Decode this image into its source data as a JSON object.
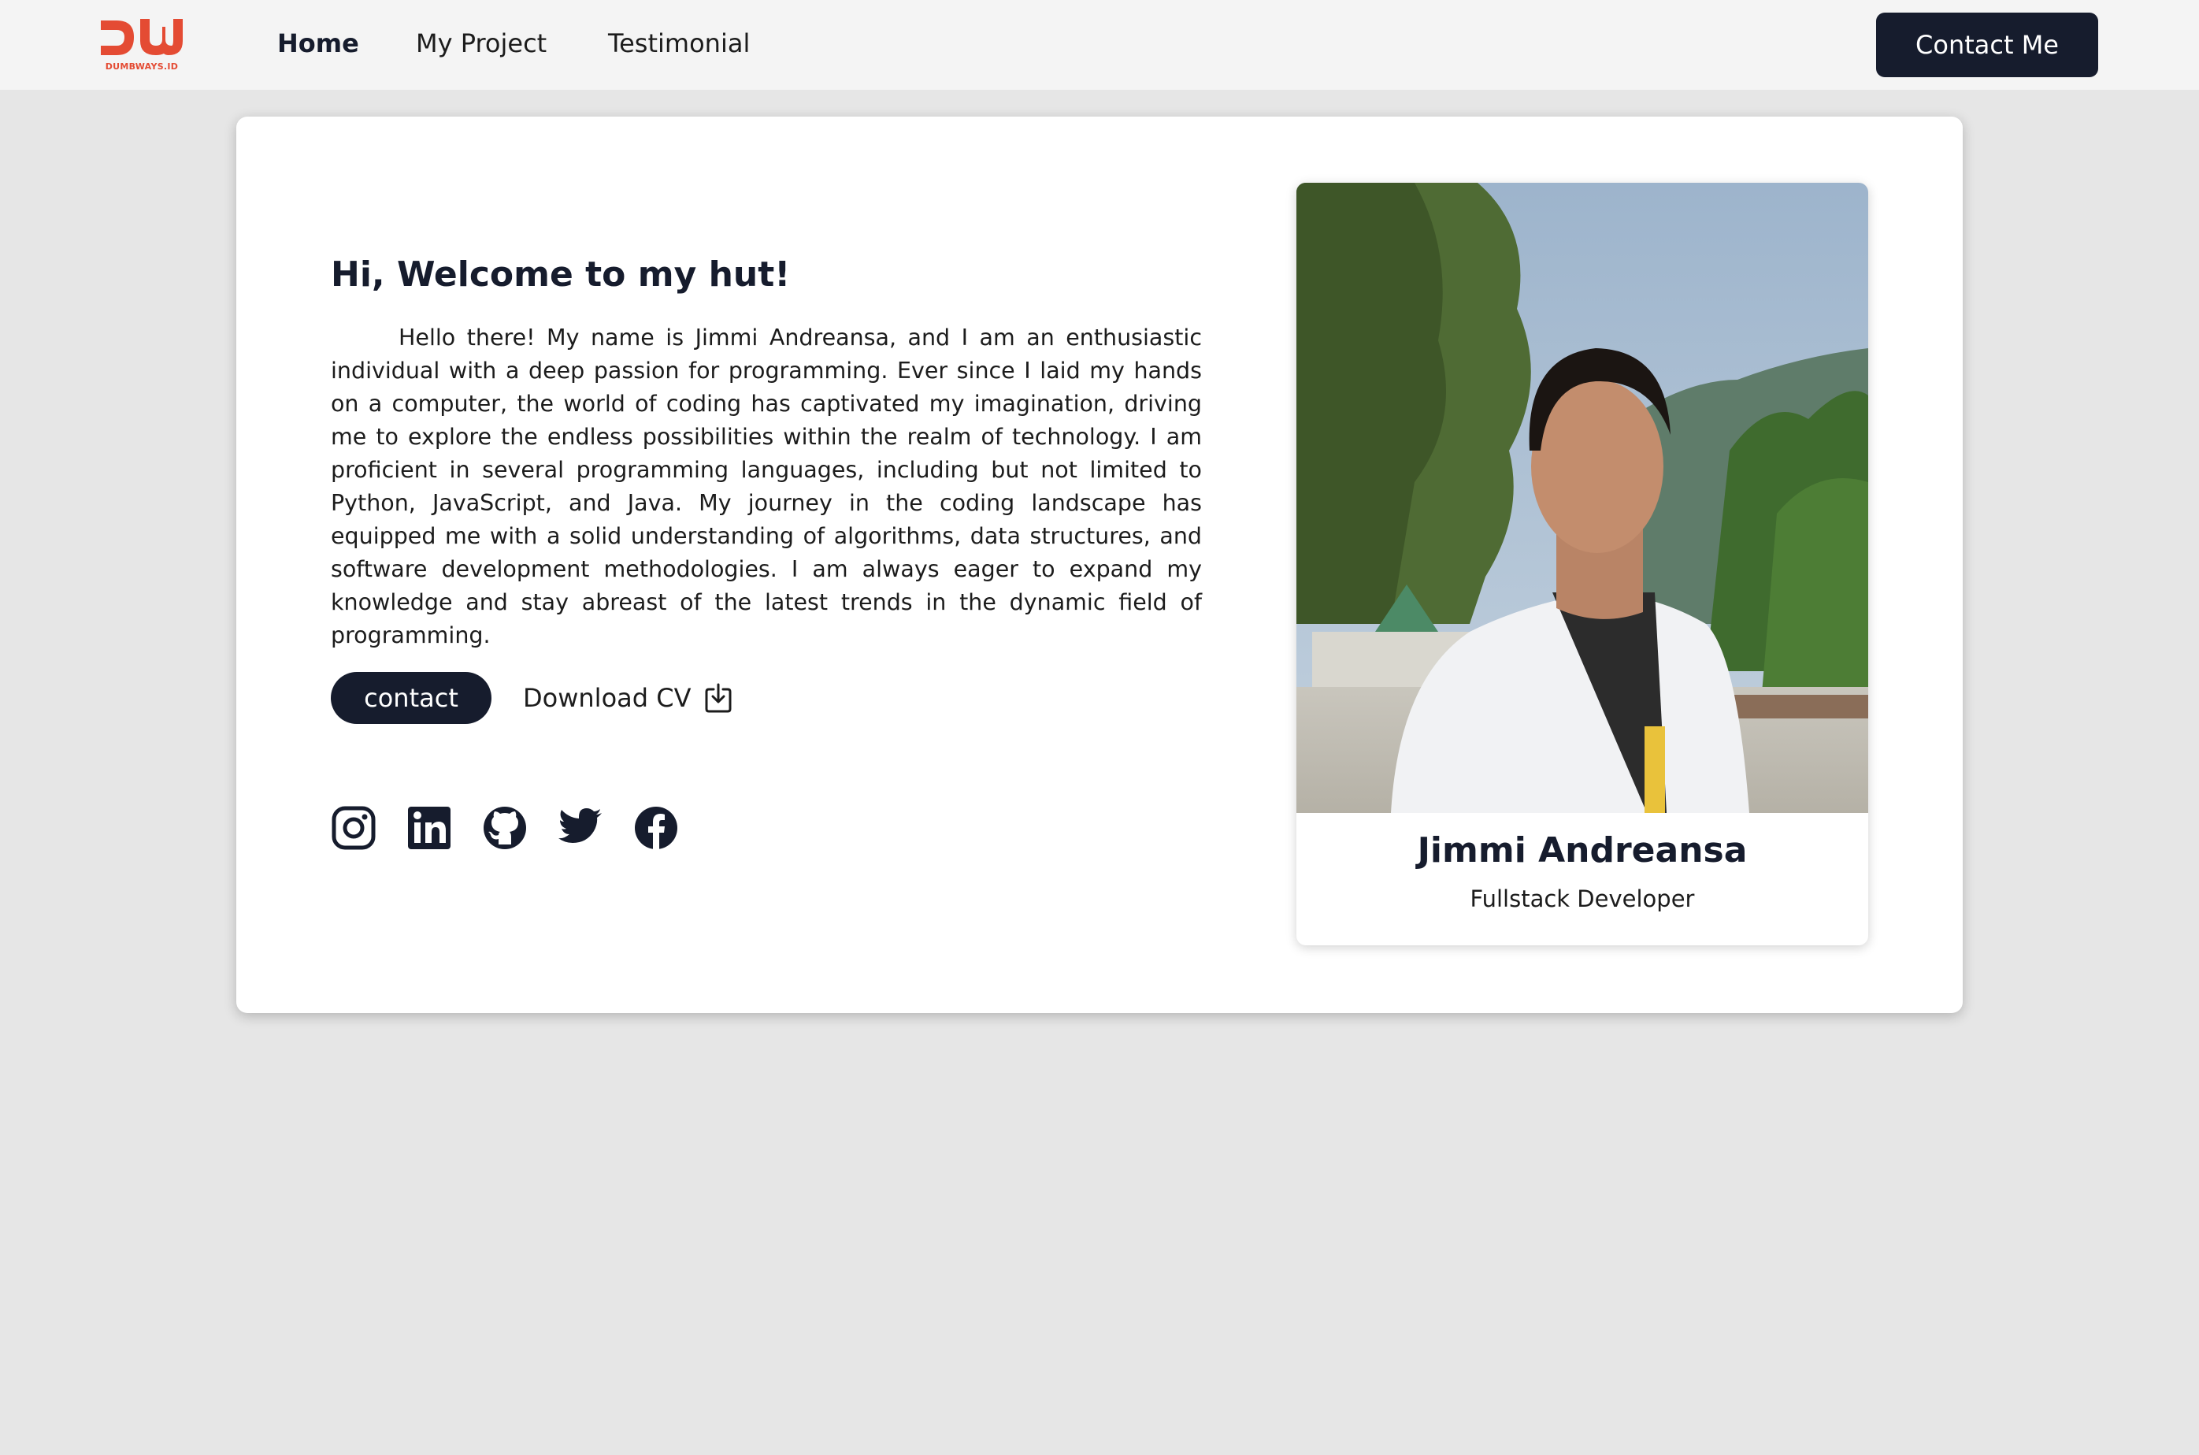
{
  "navbar": {
    "logo_text": "DUMBWAYS.ID",
    "links": [
      {
        "label": "Home",
        "active": true
      },
      {
        "label": "My Project",
        "active": false
      },
      {
        "label": "Testimonial",
        "active": false
      }
    ],
    "contact_button": "Contact Me"
  },
  "hero": {
    "heading": "Hi, Welcome to my hut!",
    "intro": "Hello there! My name is Jimmi Andreansa, and I am an enthusiastic individual with a deep passion for programming. Ever since I laid my hands on a computer, the world of coding has captivated my imagination, driving me to explore the endless possibilities within the realm of technology. I am proficient in several programming languages, including but not limited to Python, JavaScript, and Java. My journey in the coding landscape has equipped me with a solid understanding of algorithms, data structures, and software development methodologies. I am always eager to expand my knowledge and stay abreast of the latest trends in the dynamic field of programming.",
    "contact_button": "contact",
    "download_cv": "Download CV",
    "socials": [
      "instagram-icon",
      "linkedin-icon",
      "github-icon",
      "twitter-icon",
      "facebook-icon"
    ]
  },
  "profile": {
    "name": "Jimmi Andreansa",
    "role": "Fullstack Developer"
  },
  "colors": {
    "primary": "#161c2d",
    "brand": "#e44b33",
    "background": "#e6e6e6",
    "navbar": "#f4f4f4"
  }
}
